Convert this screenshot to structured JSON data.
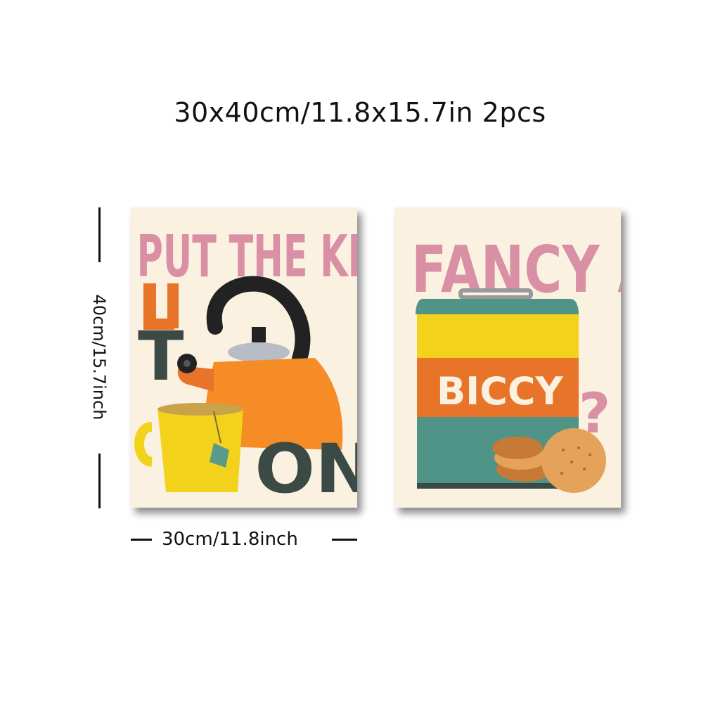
{
  "header": {
    "title": "30x40cm/11.8x15.7in 2pcs"
  },
  "dimensions": {
    "height_label": "40cm/15.7inch",
    "width_label": "30cm/11.8inch"
  },
  "posters": [
    {
      "words": {
        "line1": "PUT THE KETTLE",
        "line2": "ON",
        "letter_t": "T"
      },
      "illustration": [
        "kettle-icon",
        "mug-icon",
        "teabag-icon"
      ]
    },
    {
      "words": {
        "line1": "FANCY A",
        "label": "BICCY",
        "question": "?"
      },
      "illustration": [
        "biscuit-tin-icon",
        "biscuits-icon"
      ]
    }
  ],
  "colors": {
    "background": "#ffffff",
    "poster_bg": "#fbf1e1",
    "pink": "#d98fa4",
    "orange": "#e8742a",
    "teal": "#4f9486",
    "dark_teal": "#3b4a44",
    "yellow": "#f3d21c",
    "kettle_orange": "#f58c26",
    "biscuit": "#e5a25a"
  }
}
